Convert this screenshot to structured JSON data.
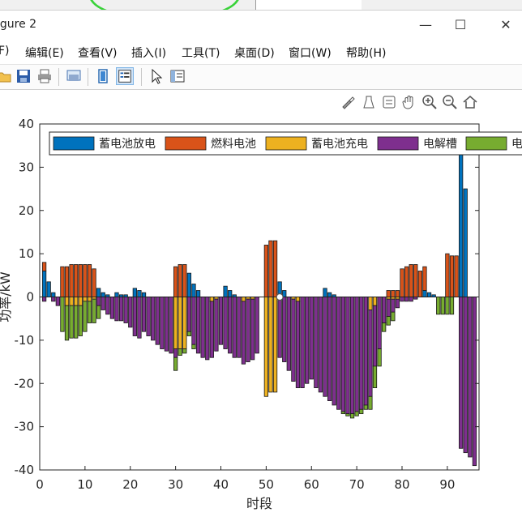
{
  "window": {
    "title": "igure 2",
    "controls": {
      "minimize": "—",
      "maximize": "☐",
      "close": "✕"
    }
  },
  "menu": [
    "F)",
    "编辑(E)",
    "查看(V)",
    "插入(I)",
    "工具(T)",
    "桌面(D)",
    "窗口(W)",
    "帮助(H)"
  ],
  "toolbar_icons": [
    "open-folder-icon",
    "save-icon",
    "print-icon",
    "print-preview-icon",
    "link-plot-icon",
    "insert-legend-icon",
    "pointer-icon",
    "property-inspector-icon"
  ],
  "axes_toolbar_icons": [
    "brush-icon",
    "data-tips-icon",
    "restore-view-icon",
    "pan-icon",
    "zoom-in-icon",
    "zoom-out-icon",
    "home-icon"
  ],
  "chart_data": {
    "type": "bar",
    "stacked": true,
    "xlabel": "时段",
    "ylabel_visible": "功率/kW",
    "xlim": [
      0,
      97
    ],
    "ylim": [
      -40,
      40
    ],
    "xticks": [
      0,
      10,
      20,
      30,
      40,
      50,
      60,
      70,
      80,
      90
    ],
    "yticks": [
      40,
      30,
      20,
      10,
      0,
      -10,
      -20,
      -30,
      -40
    ],
    "legend": {
      "placement": "top",
      "entries": [
        {
          "label": "蓄电池放电",
          "color": "#0072BD"
        },
        {
          "label": "燃料电池",
          "color": "#D95319"
        },
        {
          "label": "蓄电池充电",
          "color": "#EDB120"
        },
        {
          "label": "电解槽",
          "color": "#7E2F8E"
        },
        {
          "label": "电",
          "color": "#77AC30"
        }
      ]
    },
    "x": [
      1,
      2,
      3,
      4,
      5,
      6,
      7,
      8,
      9,
      10,
      11,
      12,
      13,
      14,
      15,
      16,
      17,
      18,
      19,
      20,
      21,
      22,
      23,
      24,
      25,
      26,
      27,
      28,
      29,
      30,
      31,
      32,
      33,
      34,
      35,
      36,
      37,
      38,
      39,
      40,
      41,
      42,
      43,
      44,
      45,
      46,
      47,
      48,
      49,
      50,
      51,
      52,
      53,
      54,
      55,
      56,
      57,
      58,
      59,
      60,
      61,
      62,
      63,
      64,
      65,
      66,
      67,
      68,
      69,
      70,
      71,
      72,
      73,
      74,
      75,
      76,
      77,
      78,
      79,
      80,
      81,
      82,
      83,
      84,
      85,
      86,
      87,
      88,
      89,
      90,
      91,
      92,
      93,
      94,
      95,
      96
    ],
    "series": [
      {
        "name": "蓄电池放电",
        "values": [
          6,
          3.5,
          1,
          0,
          0,
          0,
          0,
          0,
          0,
          0,
          0,
          0,
          2,
          1,
          0.5,
          0,
          1,
          0.5,
          0.5,
          0,
          2,
          1.5,
          1,
          0,
          0,
          0,
          0,
          0,
          0,
          0,
          0,
          0,
          5.5,
          3,
          1.5,
          0,
          0,
          0,
          0,
          0,
          2.5,
          1.5,
          0.5,
          0,
          0,
          0,
          0,
          0,
          0,
          0,
          0,
          0,
          3.5,
          1.5,
          0,
          0,
          0,
          0,
          0,
          0,
          0,
          0,
          2,
          1,
          0.5,
          0,
          0,
          0,
          0,
          0,
          0,
          0,
          0,
          0,
          0,
          0,
          0,
          0,
          0,
          0,
          0,
          0,
          0,
          0,
          1.5,
          1,
          0.5,
          0,
          0,
          0,
          0,
          0,
          38,
          25,
          0,
          0
        ]
      },
      {
        "name": "燃料电池",
        "values": [
          2,
          0,
          0,
          0,
          7,
          7,
          7.5,
          7.5,
          7.5,
          7.5,
          7.5,
          6.5,
          0,
          0,
          0,
          0,
          0,
          0,
          0,
          0,
          0,
          0,
          0,
          0,
          0,
          0,
          0,
          0,
          0,
          7,
          7.5,
          7.5,
          0,
          0,
          0,
          0,
          0,
          0,
          0,
          0,
          0,
          0,
          0,
          0,
          0,
          0,
          0,
          0,
          0,
          12,
          13,
          13,
          0,
          0,
          0,
          0,
          0,
          0,
          0,
          0,
          0,
          0,
          0,
          0,
          0,
          0,
          0,
          0,
          0,
          0,
          0,
          0,
          0,
          0,
          0,
          0,
          1.5,
          1.5,
          1.5,
          6.5,
          7,
          7.5,
          7.5,
          6,
          5.5,
          0,
          0,
          0,
          0,
          10,
          9.5,
          9.5,
          0,
          0,
          0,
          0
        ]
      },
      {
        "name": "蓄电池充电",
        "values": [
          0,
          0,
          0,
          0,
          0,
          -2,
          -2,
          -2,
          -2,
          -1,
          -1,
          -0.5,
          0,
          0,
          0,
          0,
          0,
          0,
          0,
          0,
          0,
          0,
          0,
          0,
          0,
          0,
          0,
          0,
          0,
          -12,
          -12,
          -12,
          0,
          0,
          0,
          0,
          0,
          -1,
          -0.5,
          0,
          0,
          0,
          0,
          0,
          -1,
          -0.5,
          -0.5,
          0,
          0,
          -23,
          -22,
          -22,
          0,
          0,
          0,
          -0.5,
          -1,
          0,
          0,
          0,
          0,
          0,
          0,
          0,
          0,
          0,
          0,
          0,
          0,
          0,
          0,
          0,
          -3,
          -2,
          0,
          0,
          -0.5,
          -0.5,
          -0.5,
          0,
          0,
          0,
          0,
          0,
          0,
          0,
          0,
          0,
          0,
          0,
          0,
          0,
          0,
          0,
          0,
          0
        ]
      },
      {
        "name": "电解槽",
        "values": [
          -1,
          0,
          -1,
          -2,
          0,
          0,
          0,
          0,
          0,
          0,
          0,
          0,
          -2,
          -3,
          -4,
          -5,
          -5.5,
          -5.5,
          -6,
          -7,
          -9,
          -9.5,
          -8,
          -9,
          -10,
          -11,
          -12,
          -12.5,
          -13,
          -2,
          0,
          0,
          -8,
          -11,
          -13,
          -14,
          -14.5,
          -13,
          -12,
          -11,
          -12,
          -13,
          -14,
          -14,
          -14.5,
          -14.5,
          -14,
          -13,
          0,
          0,
          0,
          0,
          -14,
          -15,
          -17,
          -19,
          -20,
          -21,
          -20,
          -19,
          -21,
          -22,
          -23,
          -24,
          -25,
          -26,
          -26.5,
          -27,
          -27,
          -26.5,
          -26,
          -25,
          -20,
          -14,
          -12,
          -6,
          -4,
          -3,
          -2,
          -1,
          -1,
          -1,
          -0.5,
          0,
          0,
          0,
          0,
          0,
          0,
          0,
          0,
          0,
          -35,
          -36,
          -37,
          -39
        ]
      },
      {
        "name": "电",
        "values": [
          0,
          0,
          0,
          0,
          -8,
          -8,
          -7.5,
          -7.5,
          -7,
          -7,
          -5,
          -5.5,
          -3,
          0,
          0,
          0,
          0,
          0,
          0,
          0,
          0,
          0,
          0,
          0,
          0,
          0,
          0,
          0,
          0,
          -3,
          -1.5,
          -1,
          -1,
          -1,
          0,
          0,
          0,
          0,
          0,
          0,
          0,
          0,
          0,
          0,
          0,
          0,
          0,
          0,
          0,
          0,
          0,
          0,
          0,
          0,
          0,
          0,
          0,
          0,
          0,
          0,
          0,
          0,
          0,
          0,
          0,
          0,
          -0.5,
          -0.5,
          -1,
          -1,
          -1,
          -1,
          -3,
          -5,
          -4,
          -2,
          -2,
          -2,
          0,
          0,
          0,
          0,
          0,
          0,
          0,
          0,
          0,
          -4,
          -4,
          -4,
          -4,
          0,
          0,
          0,
          0,
          0
        ]
      }
    ]
  }
}
